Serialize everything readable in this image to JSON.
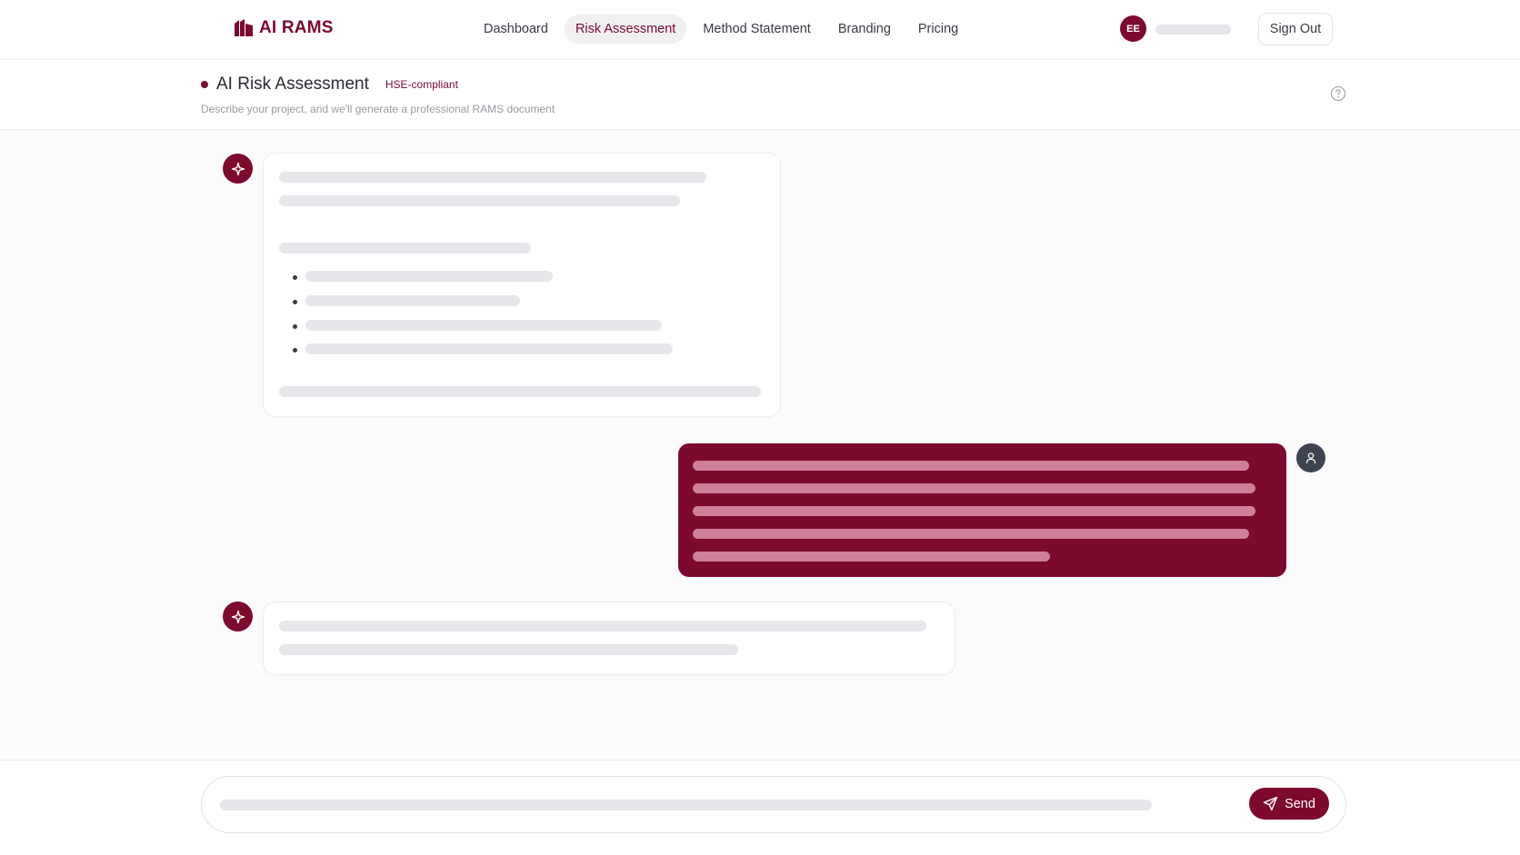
{
  "brand": {
    "name": "AI RAMS",
    "accent_color": "#7d0a2c"
  },
  "nav": {
    "items": [
      {
        "label": "Dashboard"
      },
      {
        "label": "Risk Assessment"
      },
      {
        "label": "Method Statement"
      },
      {
        "label": "Branding"
      },
      {
        "label": "Pricing"
      }
    ],
    "active": "Risk Assessment"
  },
  "user": {
    "initials": "EE",
    "sign_out_label": "Sign Out"
  },
  "header": {
    "title": "AI Risk Assessment",
    "badge": "HSE-compliant",
    "subtitle": "Describe your project, and we'll generate a professional RAMS document",
    "help_icon": "question-circle-icon"
  },
  "chat": {
    "messages": [
      {
        "role": "assistant",
        "icon": "sparkle-icon",
        "state": "loading-skeleton"
      },
      {
        "role": "user",
        "icon": "user-icon",
        "state": "loading-skeleton"
      },
      {
        "role": "assistant",
        "icon": "sparkle-icon",
        "state": "loading-skeleton"
      }
    ]
  },
  "composer": {
    "send_label": "Send",
    "send_icon": "paper-plane-icon"
  }
}
